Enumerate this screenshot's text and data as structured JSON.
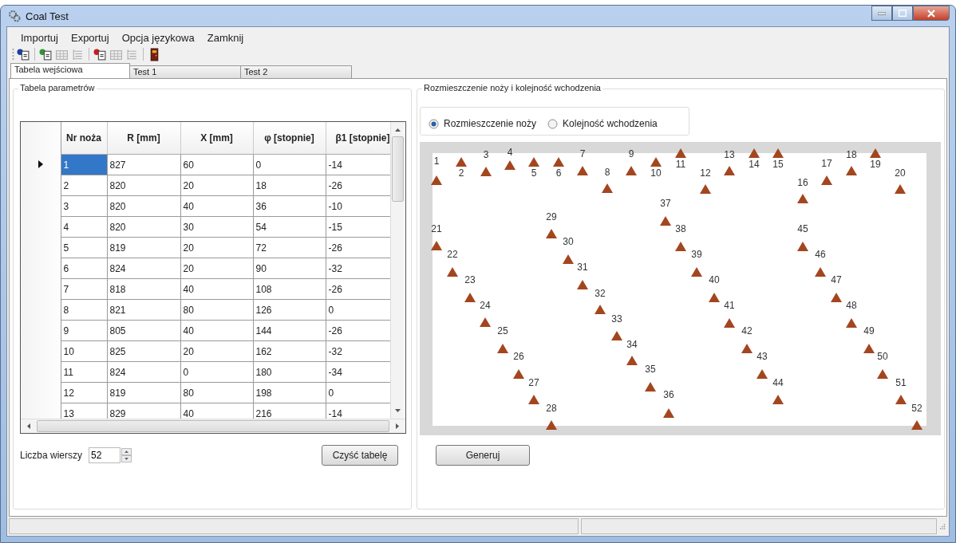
{
  "window": {
    "title": "Coal Test"
  },
  "menu": [
    "Importuj",
    "Exportuj",
    "Opcja językowa",
    "Zamknij"
  ],
  "tabs": [
    {
      "label": "Tabela wejściowa",
      "selected": true
    },
    {
      "label": "Test 1",
      "selected": false
    },
    {
      "label": "Test 2",
      "selected": false
    }
  ],
  "parameters_panel": {
    "title": "Tabela parametrów",
    "table": {
      "columns": [
        "Nr noża",
        "R [mm]",
        "X [mm]",
        "φ [stopnie]",
        "β1 [stopnie]"
      ],
      "rows": [
        {
          "cells": [
            "1",
            "827",
            "60",
            "0",
            "-14"
          ],
          "selected": true
        },
        {
          "cells": [
            "2",
            "820",
            "20",
            "18",
            "-26"
          ],
          "selected": false
        },
        {
          "cells": [
            "3",
            "820",
            "40",
            "36",
            "-10"
          ],
          "selected": false
        },
        {
          "cells": [
            "4",
            "820",
            "30",
            "54",
            "-15"
          ],
          "selected": false
        },
        {
          "cells": [
            "5",
            "819",
            "20",
            "72",
            "-26"
          ],
          "selected": false
        },
        {
          "cells": [
            "6",
            "824",
            "20",
            "90",
            "-32"
          ],
          "selected": false
        },
        {
          "cells": [
            "7",
            "818",
            "40",
            "108",
            "-26"
          ],
          "selected": false
        },
        {
          "cells": [
            "8",
            "821",
            "80",
            "126",
            "0"
          ],
          "selected": false
        },
        {
          "cells": [
            "9",
            "805",
            "40",
            "144",
            "-26"
          ],
          "selected": false
        },
        {
          "cells": [
            "10",
            "825",
            "20",
            "162",
            "-32"
          ],
          "selected": false
        },
        {
          "cells": [
            "11",
            "824",
            "0",
            "180",
            "-34"
          ],
          "selected": false
        },
        {
          "cells": [
            "12",
            "819",
            "80",
            "198",
            "0"
          ],
          "selected": false
        },
        {
          "cells": [
            "13",
            "829",
            "40",
            "216",
            "-14"
          ],
          "selected": false
        }
      ]
    },
    "row_count": {
      "label": "Liczba wierszy",
      "value": "52"
    },
    "clear_button": "Czyść tabelę"
  },
  "layout_panel": {
    "title": "Rozmieszczenie noży i kolejność wchodzenia",
    "modes": [
      {
        "label": "Rozmieszczenie noży",
        "selected": true
      },
      {
        "label": "Kolejność wchodzenia",
        "selected": false
      }
    ],
    "knives": [
      "1",
      "2",
      "3",
      "4",
      "5",
      "6",
      "7",
      "8",
      "9",
      "10",
      "11",
      "12",
      "13",
      "14",
      "15",
      "16",
      "17",
      "18",
      "19",
      "20",
      "21",
      "22",
      "23",
      "24",
      "25",
      "26",
      "27",
      "28",
      "29",
      "30",
      "31",
      "32",
      "33",
      "34",
      "35",
      "36",
      "37",
      "38",
      "39",
      "40",
      "41",
      "42",
      "43",
      "44",
      "45",
      "46",
      "47",
      "48",
      "49",
      "50",
      "51",
      "52"
    ],
    "generate_button": "Generuj"
  }
}
